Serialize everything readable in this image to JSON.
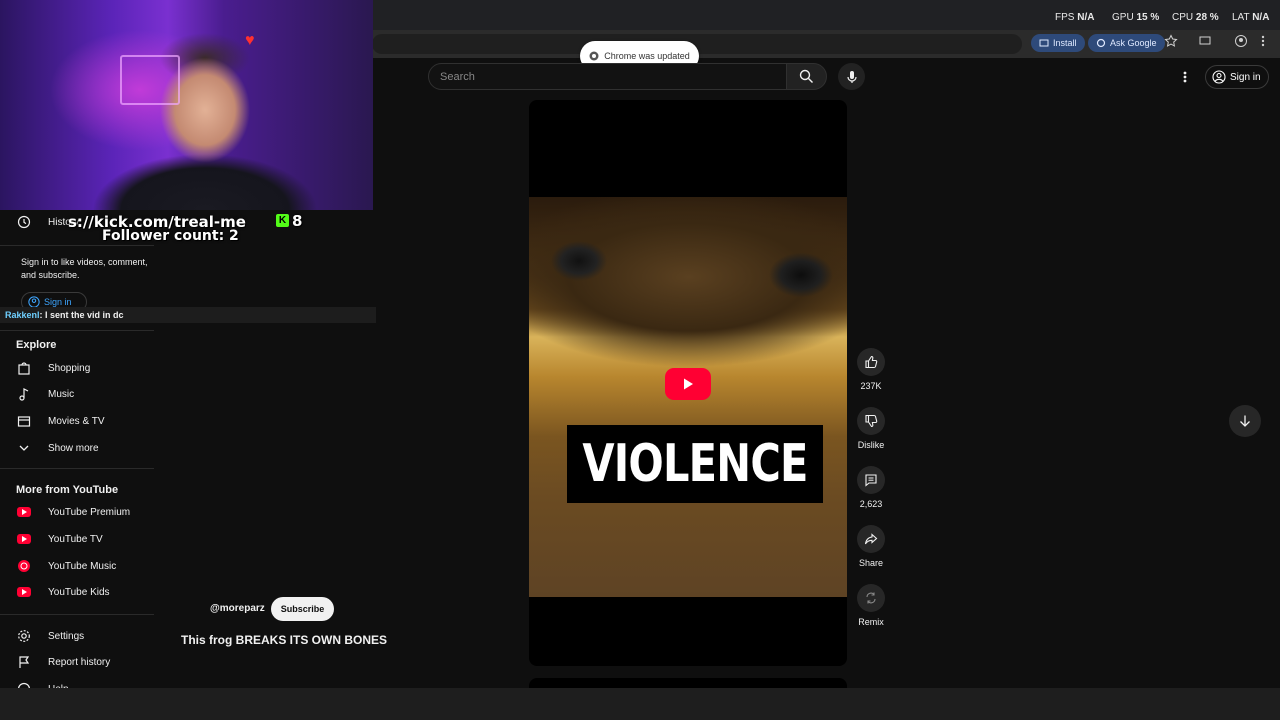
{
  "perf": {
    "fps_label": "FPS",
    "fps_value": "N/A",
    "gpu_label": "GPU",
    "gpu_value": "15 %",
    "cpu_label": "CPU",
    "cpu_value": "28 %",
    "lat_label": "LAT",
    "lat_value": "N/A"
  },
  "browser": {
    "install_label": "Install",
    "ask_google_label": "Ask Google",
    "toast": "Chrome was updated"
  },
  "header": {
    "search_placeholder": "Search",
    "sign_in": "Sign in"
  },
  "stream": {
    "kick_url": "s://kick.com/treal-me",
    "kick_count": "8",
    "follower": "Follower count: 2",
    "kick_logo": "K",
    "chat_user": "Rakkenl",
    "chat_message": ": I sent the vid in dc"
  },
  "sidebar": {
    "history": "History",
    "signin_text": "Sign in to like videos, comment, and subscribe.",
    "signin_button": "Sign in",
    "explore_heading": "Explore",
    "explore": [
      {
        "label": "Shopping",
        "icon": "shopping-bag-icon"
      },
      {
        "label": "Music",
        "icon": "music-note-icon"
      },
      {
        "label": "Movies & TV",
        "icon": "clapperboard-icon"
      },
      {
        "label": "Show more",
        "icon": "chevron-down-icon"
      }
    ],
    "more_heading": "More from YouTube",
    "more": [
      {
        "label": "YouTube Premium"
      },
      {
        "label": "YouTube TV"
      },
      {
        "label": "YouTube Music"
      },
      {
        "label": "YouTube Kids"
      }
    ],
    "footer": [
      {
        "label": "Settings",
        "icon": "gear-icon"
      },
      {
        "label": "Report history",
        "icon": "flag-icon"
      },
      {
        "label": "Help",
        "icon": "help-icon"
      }
    ]
  },
  "video": {
    "overlay_text": "VIOLENCE",
    "channel": "@moreparz",
    "subscribe": "Subscribe",
    "title": "This frog BREAKS ITS OWN BONES"
  },
  "actions": {
    "like_count": "237K",
    "dislike": "Dislike",
    "comments_count": "2,623",
    "share": "Share",
    "remix": "Remix"
  },
  "colors": {
    "accent_red": "#ff0033",
    "kick_green": "#53fc18",
    "background": "#0f0f0f"
  }
}
